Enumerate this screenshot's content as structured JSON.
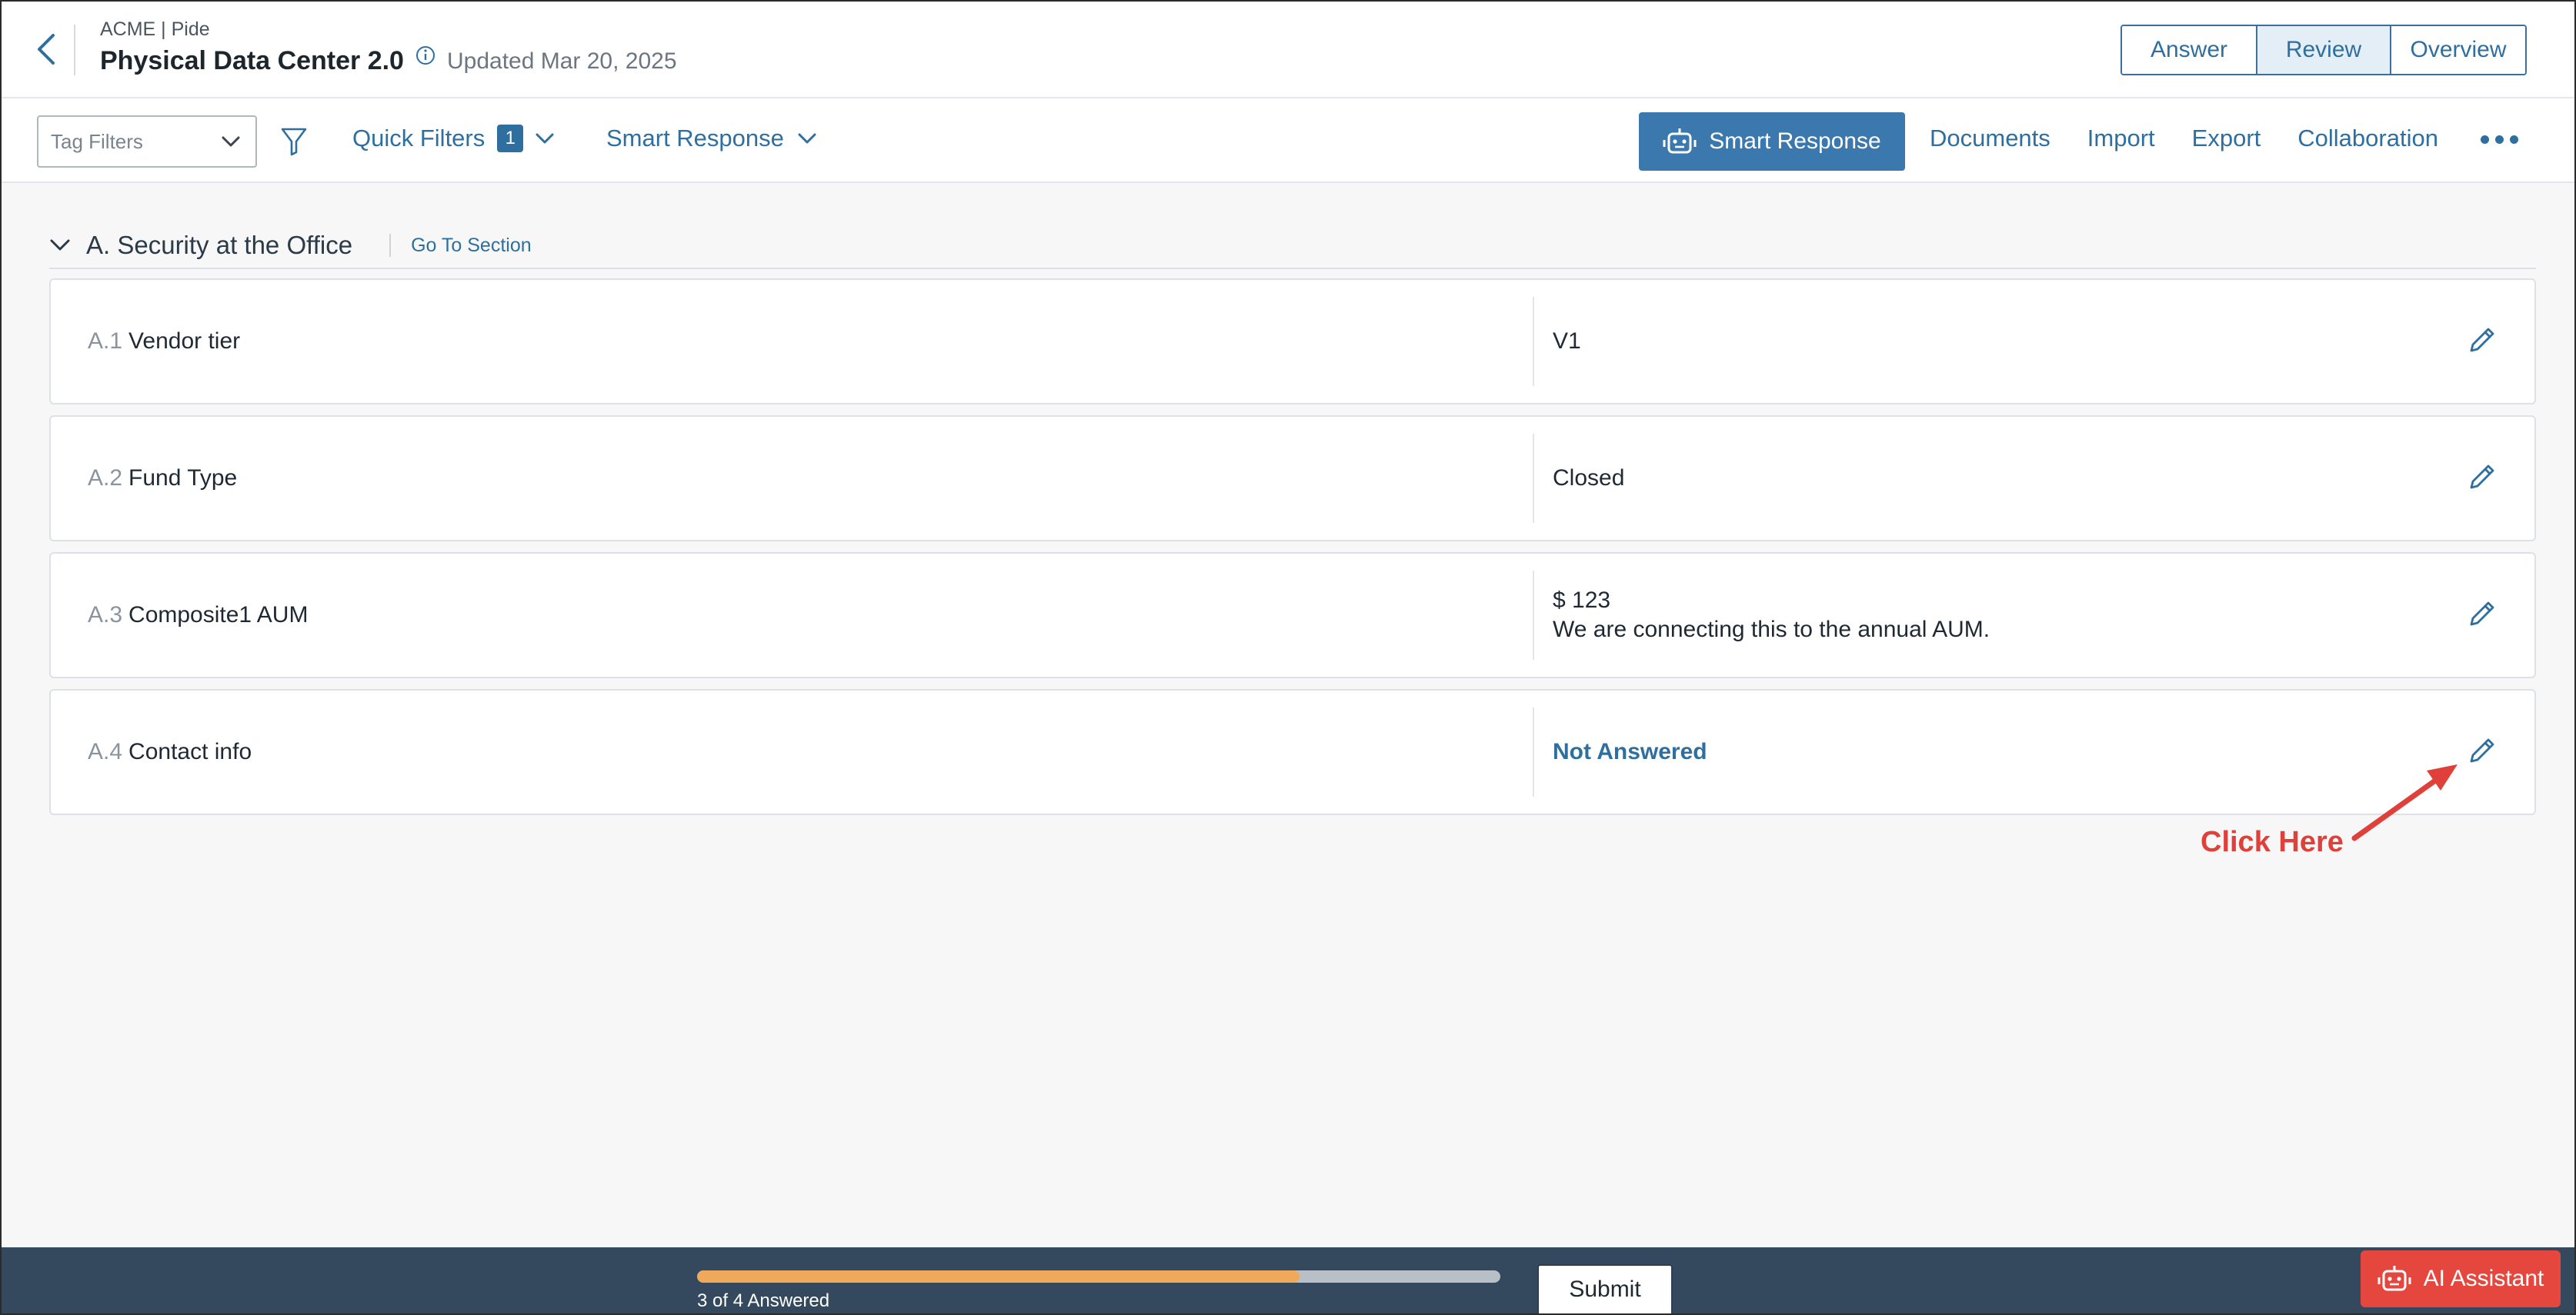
{
  "header": {
    "org": "ACME | Pide",
    "title": "Physical Data Center 2.0",
    "updated": "Updated Mar 20, 2025",
    "views": [
      "Answer",
      "Review",
      "Overview"
    ],
    "active_view": "Review"
  },
  "toolbar": {
    "tag_filters_placeholder": "Tag Filters",
    "quick_filters_label": "Quick Filters",
    "quick_filters_count": "1",
    "smart_response_dropdown": "Smart Response",
    "smart_response_button": "Smart Response",
    "links": [
      "Documents",
      "Import",
      "Export",
      "Collaboration"
    ]
  },
  "section": {
    "title": "A. Security at the Office",
    "go_to": "Go To Section"
  },
  "questions": [
    {
      "num": "A.1",
      "label": "Vendor tier",
      "answer_lines": [
        "V1"
      ],
      "answered": true
    },
    {
      "num": "A.2",
      "label": "Fund Type",
      "answer_lines": [
        "Closed"
      ],
      "answered": true
    },
    {
      "num": "A.3",
      "label": "Composite1 AUM",
      "answer_lines": [
        "$ 123",
        "We are connecting this to the annual AUM."
      ],
      "answered": true
    },
    {
      "num": "A.4",
      "label": "Contact info",
      "answer_lines": [
        "Not Answered"
      ],
      "answered": false
    }
  ],
  "annotation": {
    "text": "Click Here",
    "color": "#e0403a"
  },
  "footer": {
    "progress_text": "3 of 4 Answered",
    "progress_fraction": 0.75,
    "submit_label": "Submit",
    "ai_assistant_label": "AI Assistant"
  },
  "colors": {
    "accent": "#2f6f9f",
    "primary_button": "#3a78ad",
    "footer_bg": "#34495e",
    "progress_fill": "#f0a85a",
    "ai_button": "#e5473f"
  }
}
